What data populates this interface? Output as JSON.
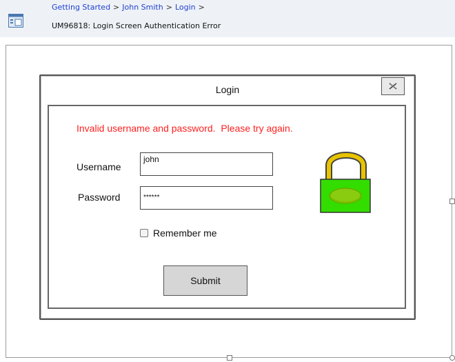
{
  "breadcrumb": {
    "items": [
      "Getting Started",
      "John Smith",
      "Login"
    ],
    "separator": ">",
    "current": "UM96818: Login Screen Authentication Error"
  },
  "dialog": {
    "title": "Login",
    "error": "Invalid username and password.  Please try again.",
    "username_label": "Username",
    "username_value": "john",
    "password_label": "Password",
    "password_value": "******",
    "remember_label": "Remember me",
    "submit_label": "Submit"
  },
  "colors": {
    "error": "#ff2020",
    "link": "#1e3fd0",
    "lock_body": "#33dd00",
    "lock_shackle": "#e8c400"
  },
  "icons": [
    "app-window-icon",
    "close-icon",
    "padlock-icon",
    "checkbox-icon"
  ]
}
